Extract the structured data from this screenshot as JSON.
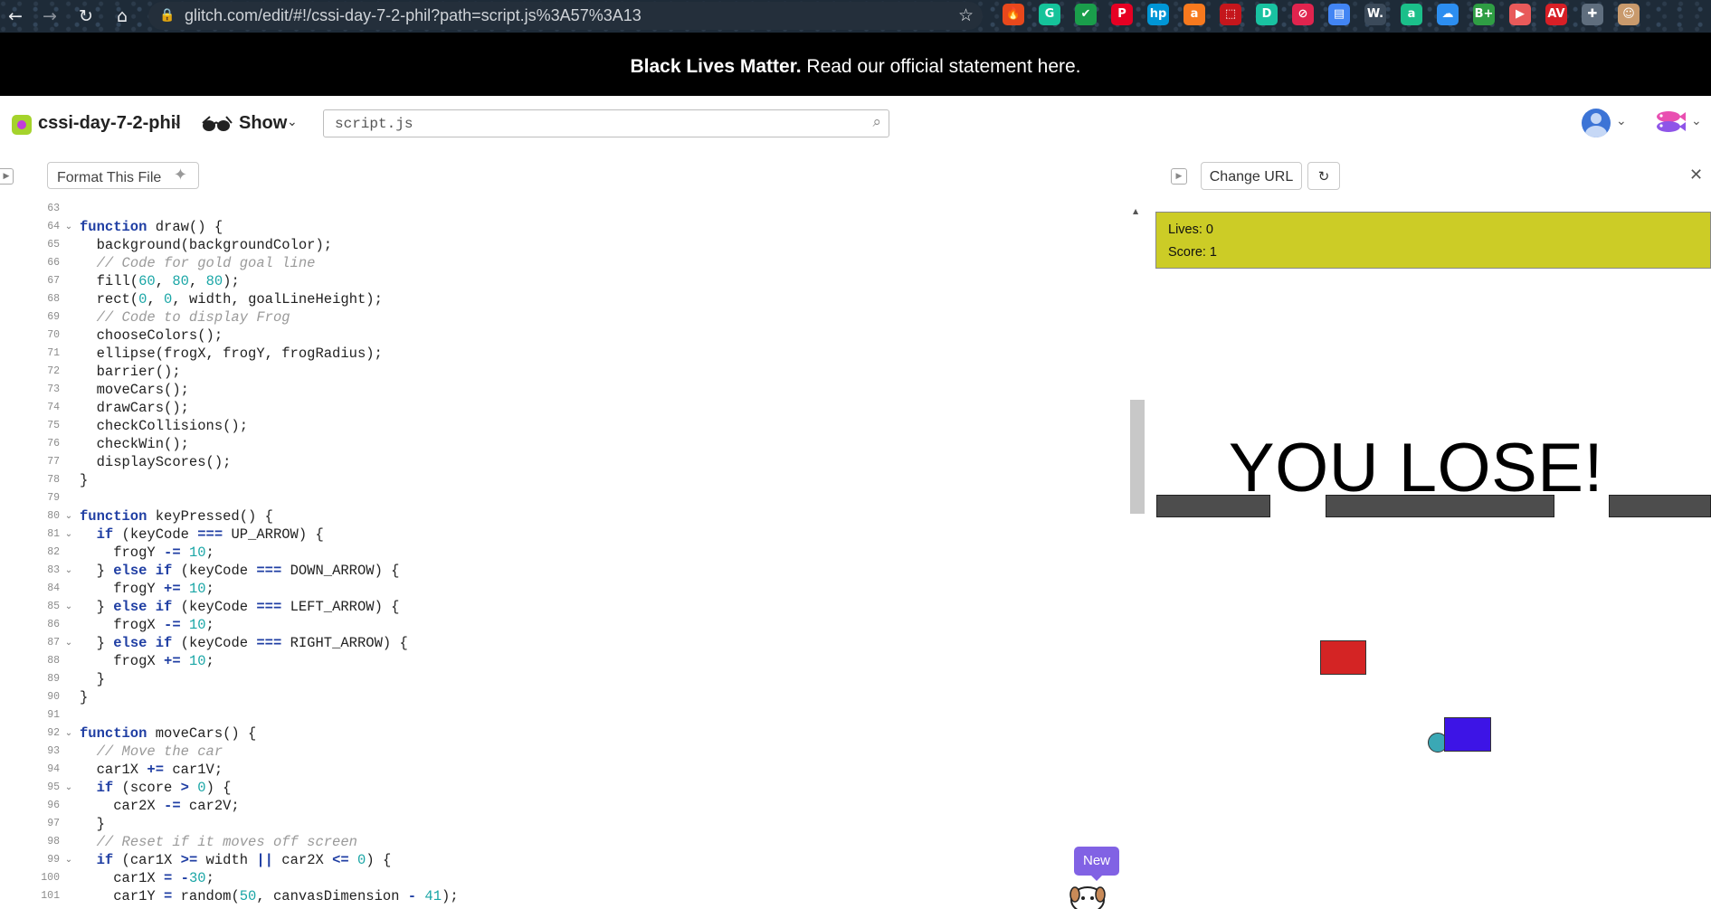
{
  "browser": {
    "url": "glitch.com/edit/#!/cssi-day-7-2-phil?path=script.js%3A57%3A13",
    "nav": {
      "back": "back",
      "forward": "forward",
      "reload": "reload",
      "home": "home"
    },
    "extensions": [
      {
        "name": "honey-extension-icon",
        "glyph": "🔥",
        "color": "#e8481c"
      },
      {
        "name": "grammarly-extension-icon",
        "glyph": "G",
        "color": "#15c39a"
      },
      {
        "name": "checklist-extension-icon",
        "glyph": "✔",
        "color": "#1a9e4b"
      },
      {
        "name": "pinterest-extension-icon",
        "glyph": "P",
        "color": "#e60023"
      },
      {
        "name": "hp-extension-icon",
        "glyph": "hp",
        "color": "#0096d6"
      },
      {
        "name": "shopping-extension-icon",
        "glyph": "a",
        "color": "#f7791e"
      },
      {
        "name": "pdf-extension-icon",
        "glyph": "⬚",
        "color": "#c4161c"
      },
      {
        "name": "d-extension-icon",
        "glyph": "D",
        "color": "#19c2a1"
      },
      {
        "name": "blocker-extension-icon",
        "glyph": "⊘",
        "color": "#e0244e"
      },
      {
        "name": "docs-extension-icon",
        "glyph": "▤",
        "color": "#4285f4"
      },
      {
        "name": "w-extension-icon",
        "glyph": "W.",
        "color": "#3b4a5a"
      },
      {
        "name": "cursive-extension-icon",
        "glyph": "a",
        "color": "#1bbf8a"
      },
      {
        "name": "cloud-extension-icon",
        "glyph": "☁",
        "color": "#2c8ef0"
      },
      {
        "name": "b-plus-extension-icon",
        "glyph": "B+",
        "color": "#2f9e44"
      },
      {
        "name": "video-extension-icon",
        "glyph": "▶",
        "color": "#e85a5a"
      },
      {
        "name": "av-extension-icon",
        "glyph": "AV",
        "color": "#d81f26"
      },
      {
        "name": "puzzle-extension-icon",
        "glyph": "✚",
        "color": "#5f6e7e"
      },
      {
        "name": "profile-extension-icon",
        "glyph": "☺",
        "color": "#c99a6c"
      }
    ]
  },
  "banner": {
    "bold": "Black Lives Matter.",
    "text": " Read our official statement here."
  },
  "header": {
    "project_name": "cssi-day-7-2-phil",
    "show_label": "Show",
    "search_value": "script.js"
  },
  "editor": {
    "format_button": "Format This File",
    "lines": [
      {
        "n": "63",
        "fold": false,
        "html": ""
      },
      {
        "n": "64",
        "fold": true,
        "html": "<span class=\"kw\">function</span> draw() {"
      },
      {
        "n": "65",
        "fold": false,
        "html": "  background(backgroundColor);"
      },
      {
        "n": "66",
        "fold": false,
        "html": "  <span class=\"cm\">// Code for gold goal line</span>"
      },
      {
        "n": "67",
        "fold": false,
        "html": "  fill(<span class=\"num\">60</span>, <span class=\"num\">80</span>, <span class=\"num\">80</span>);"
      },
      {
        "n": "68",
        "fold": false,
        "html": "  rect(<span class=\"num\">0</span>, <span class=\"num\">0</span>, width, goalLineHeight);"
      },
      {
        "n": "69",
        "fold": false,
        "html": "  <span class=\"cm\">// Code to display Frog</span>"
      },
      {
        "n": "70",
        "fold": false,
        "html": "  chooseColors();"
      },
      {
        "n": "71",
        "fold": false,
        "html": "  ellipse(frogX, frogY, frogRadius);"
      },
      {
        "n": "72",
        "fold": false,
        "html": "  barrier();"
      },
      {
        "n": "73",
        "fold": false,
        "html": "  moveCars();"
      },
      {
        "n": "74",
        "fold": false,
        "html": "  drawCars();"
      },
      {
        "n": "75",
        "fold": false,
        "html": "  checkCollisions();"
      },
      {
        "n": "76",
        "fold": false,
        "html": "  checkWin();"
      },
      {
        "n": "77",
        "fold": false,
        "html": "  displayScores();"
      },
      {
        "n": "78",
        "fold": false,
        "html": "}"
      },
      {
        "n": "79",
        "fold": false,
        "html": ""
      },
      {
        "n": "80",
        "fold": true,
        "html": "<span class=\"kw\">function</span> keyPressed() {"
      },
      {
        "n": "81",
        "fold": true,
        "html": "  <span class=\"kw\">if</span> (keyCode <span class=\"kw\">===</span> UP_ARROW) {"
      },
      {
        "n": "82",
        "fold": false,
        "html": "    frogY <span class=\"kw\">-=</span> <span class=\"num\">10</span>;"
      },
      {
        "n": "83",
        "fold": true,
        "html": "  } <span class=\"kw\">else if</span> (keyCode <span class=\"kw\">===</span> DOWN_ARROW) {"
      },
      {
        "n": "84",
        "fold": false,
        "html": "    frogY <span class=\"kw\">+=</span> <span class=\"num\">10</span>;"
      },
      {
        "n": "85",
        "fold": true,
        "html": "  } <span class=\"kw\">else if</span> (keyCode <span class=\"kw\">===</span> LEFT_ARROW) {"
      },
      {
        "n": "86",
        "fold": false,
        "html": "    frogX <span class=\"kw\">-=</span> <span class=\"num\">10</span>;"
      },
      {
        "n": "87",
        "fold": true,
        "html": "  } <span class=\"kw\">else if</span> (keyCode <span class=\"kw\">===</span> RIGHT_ARROW) {"
      },
      {
        "n": "88",
        "fold": false,
        "html": "    frogX <span class=\"kw\">+=</span> <span class=\"num\">10</span>;"
      },
      {
        "n": "89",
        "fold": false,
        "html": "  }"
      },
      {
        "n": "90",
        "fold": false,
        "html": "}"
      },
      {
        "n": "91",
        "fold": false,
        "html": ""
      },
      {
        "n": "92",
        "fold": true,
        "html": "<span class=\"kw\">function</span> moveCars() {"
      },
      {
        "n": "93",
        "fold": false,
        "html": "  <span class=\"cm\">// Move the car</span>"
      },
      {
        "n": "94",
        "fold": false,
        "html": "  car1X <span class=\"kw\">+=</span> car1V;"
      },
      {
        "n": "95",
        "fold": true,
        "html": "  <span class=\"kw\">if</span> (score <span class=\"kw\">&gt;</span> <span class=\"num\">0</span>) {"
      },
      {
        "n": "96",
        "fold": false,
        "html": "    car2X <span class=\"kw\">-=</span> car2V;"
      },
      {
        "n": "97",
        "fold": false,
        "html": "  }"
      },
      {
        "n": "98",
        "fold": false,
        "html": "  <span class=\"cm\">// Reset if it moves off screen</span>"
      },
      {
        "n": "99",
        "fold": true,
        "html": "  <span class=\"kw\">if</span> (car1X <span class=\"kw\">&gt;=</span> width <span class=\"kw\">||</span> car2X <span class=\"kw\">&lt;=</span> <span class=\"num\">0</span>) {"
      },
      {
        "n": "100",
        "fold": false,
        "html": "    car1X <span class=\"kw\">=</span> <span class=\"kw\">-</span><span class=\"num\">30</span>;"
      },
      {
        "n": "101",
        "fold": false,
        "html": "    car1Y <span class=\"kw\">=</span> random(<span class=\"num\">50</span>, canvasDimension <span class=\"kw\">-</span> <span class=\"num\">41</span>);"
      }
    ]
  },
  "preview": {
    "change_url": "Change URL",
    "lives": "Lives: 0",
    "score": "Score: 1",
    "message": "YOU LOSE!",
    "new_badge": "New"
  }
}
